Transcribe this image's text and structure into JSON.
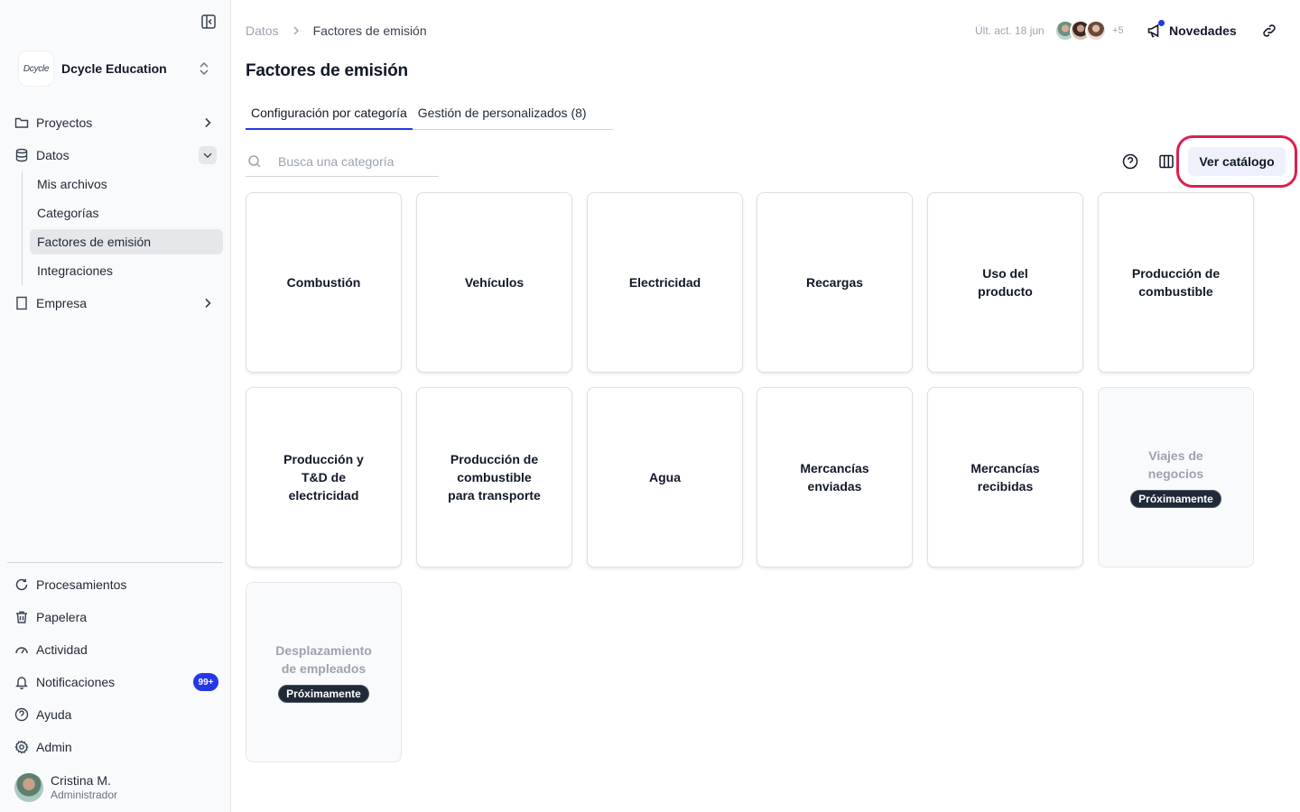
{
  "org": {
    "logo_text": "Dcycle",
    "name": "Dcycle Education"
  },
  "sidebar": {
    "nav": [
      {
        "label": "Proyectos"
      },
      {
        "label": "Datos"
      },
      {
        "label": "Empresa"
      }
    ],
    "datos_sub": [
      {
        "label": "Mis archivos"
      },
      {
        "label": "Categorías"
      },
      {
        "label": "Factores de emisión"
      },
      {
        "label": "Integraciones"
      }
    ],
    "bottom": [
      {
        "label": "Procesamientos"
      },
      {
        "label": "Papelera"
      },
      {
        "label": "Actividad"
      },
      {
        "label": "Notificaciones",
        "badge": "99+"
      },
      {
        "label": "Ayuda"
      },
      {
        "label": "Admin"
      }
    ],
    "user": {
      "name": "Cristina M.",
      "role": "Administrador"
    }
  },
  "header": {
    "breadcrumb": {
      "parent": "Datos",
      "current": "Factores de emisión"
    },
    "last_updated": "Últ. act. 18 jun",
    "more_users": "+5",
    "news_label": "Novedades"
  },
  "page": {
    "title": "Factores de emisión",
    "tabs": [
      {
        "label": "Configuración por categoría"
      },
      {
        "label": "Gestión de personalizados (8)"
      }
    ],
    "search_placeholder": "Busca una categoría",
    "catalog_button": "Ver catálogo"
  },
  "cards": [
    {
      "label": "Combustión"
    },
    {
      "label": "Vehículos"
    },
    {
      "label": "Electricidad"
    },
    {
      "label": "Recargas"
    },
    {
      "label": "Uso del producto"
    },
    {
      "label": "Producción de combustible"
    },
    {
      "label": "Producción y T&D de electricidad"
    },
    {
      "label": "Producción de combustible para transporte"
    },
    {
      "label": "Agua"
    },
    {
      "label": "Mercancías enviadas"
    },
    {
      "label": "Mercancías recibidas"
    },
    {
      "label": "Viajes de negocios",
      "badge": "Próximamente"
    },
    {
      "label": "Desplazamiento de empleados",
      "badge": "Próximamente"
    }
  ],
  "colors": {
    "accent": "#2537e5",
    "highlight": "#dc1f4f",
    "badge_dark": "#1f2937"
  }
}
